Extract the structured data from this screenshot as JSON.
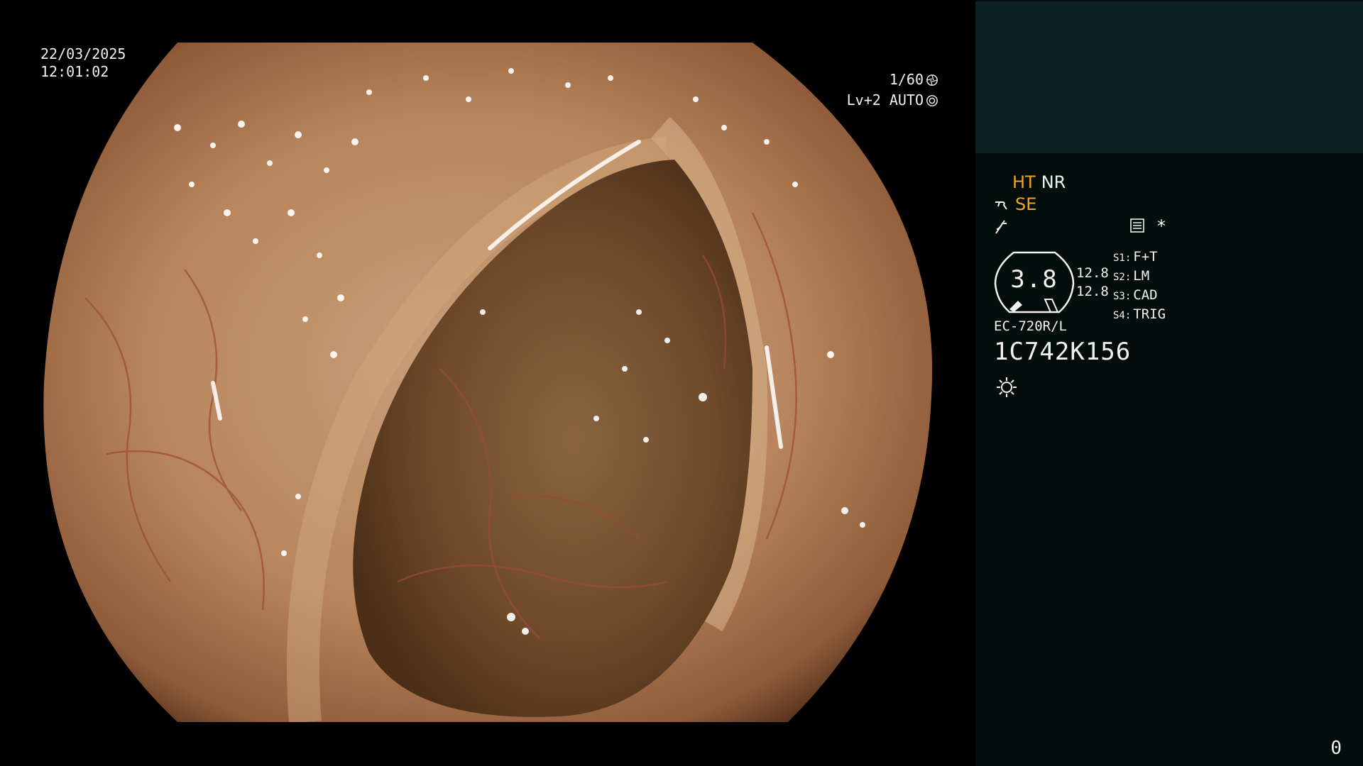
{
  "view": {
    "date": "22/03/2025",
    "time": "12:01:02",
    "shutter": "1/60",
    "iris": "Lv+2 AUTO"
  },
  "panel": {
    "modes": {
      "ht": "HT",
      "nr": "NR",
      "se": "SE",
      "asterisk": "*"
    },
    "gauge": {
      "value": "3.8",
      "upper": "12.8",
      "lower": "12.8"
    },
    "switches": [
      {
        "key": "S1:",
        "label": "F+T"
      },
      {
        "key": "S2:",
        "label": "LM"
      },
      {
        "key": "S3:",
        "label": "CAD"
      },
      {
        "key": "S4:",
        "label": "TRIG"
      }
    ],
    "scope_model": "EC-720R/L",
    "serial": "1C742K156",
    "counter": "0"
  },
  "colors": {
    "mode_active": "#f2a51a",
    "panel_bg": "#030d0c",
    "panel_top_bg": "#0b2222"
  },
  "icons": {
    "shutter": "shutter-icon",
    "iris": "iris-icon",
    "scope": "scope-hook-icon",
    "structure": "structure-enhance-icon",
    "settings": "settings-list-icon",
    "light": "light-sun-icon"
  }
}
